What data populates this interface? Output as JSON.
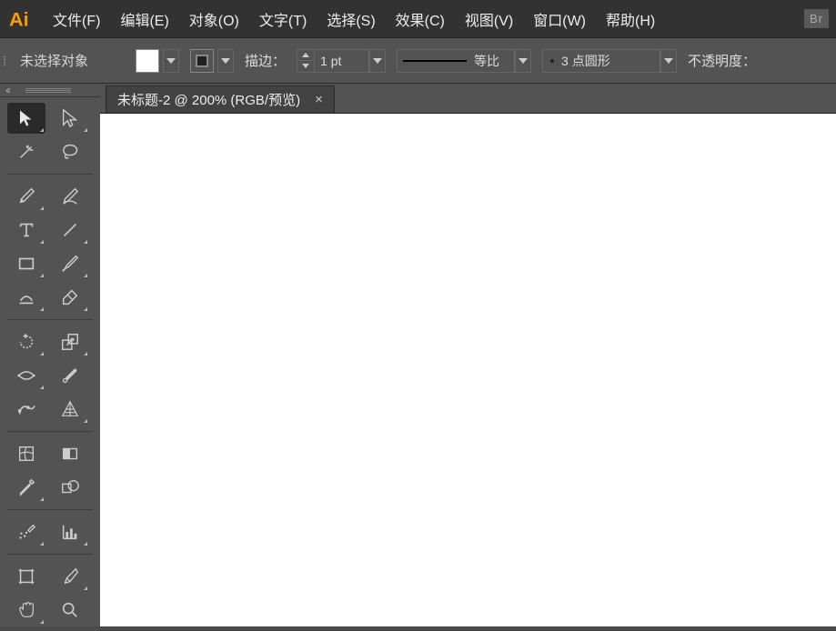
{
  "app": {
    "name": "Adobe Illustrator",
    "bridge_label": "Br"
  },
  "menu": [
    "文件(F)",
    "编辑(E)",
    "对象(O)",
    "文字(T)",
    "选择(S)",
    "效果(C)",
    "视图(V)",
    "窗口(W)",
    "帮助(H)"
  ],
  "control": {
    "status": "未选择对象",
    "stroke_label": "描边：",
    "stroke_value": "1 pt",
    "style_label": "等比",
    "dash_label": "3 点圆形",
    "opacity_label": "不透明度："
  },
  "tab": {
    "title": "未标题-2 @ 200% (RGB/预览)",
    "close": "×"
  },
  "tools": {
    "selection": "selection-tool",
    "direct": "direct-selection-tool",
    "wand": "magic-wand-tool",
    "lasso": "lasso-tool",
    "pen": "pen-tool",
    "curvature": "curvature-tool",
    "type": "type-tool",
    "line": "line-tool",
    "rect": "rectangle-tool",
    "brush": "paintbrush-tool",
    "shaper": "shaper-tool",
    "eraser": "eraser-tool",
    "rotate": "rotate-tool",
    "scale": "scale-tool",
    "width": "width-tool",
    "free": "free-transform-tool",
    "puppet": "puppet-warp-tool",
    "perspective": "perspective-grid-tool",
    "mesh": "mesh-tool",
    "gradient": "gradient-tool",
    "eyedrop": "eyedropper-tool",
    "blend": "blend-tool",
    "symbol": "symbol-sprayer-tool",
    "graph": "column-graph-tool",
    "artboard": "artboard-tool",
    "slice": "slice-tool",
    "hand": "hand-tool",
    "zoom": "zoom-tool"
  }
}
